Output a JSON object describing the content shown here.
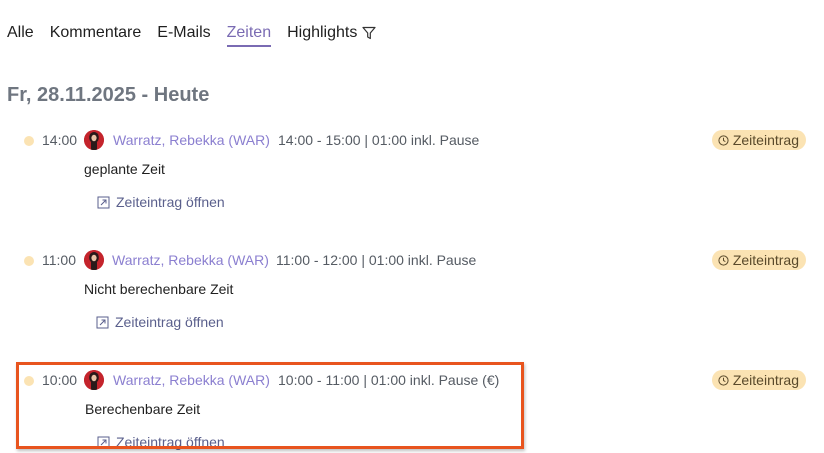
{
  "tabs": [
    {
      "label": "Alle",
      "active": false
    },
    {
      "label": "Kommentare",
      "active": false
    },
    {
      "label": "E-Mails",
      "active": false
    },
    {
      "label": "Zeiten",
      "active": true
    },
    {
      "label": "Highlights",
      "active": false,
      "icon": "filter-icon"
    }
  ],
  "date_heading": "Fr, 28.11.2025 - Heute",
  "entries": [
    {
      "time": "14:00",
      "user": "Warratz, Rebekka (WAR)",
      "details": "14:00 - 15:00 | 01:00 inkl. Pause",
      "badge": "Zeiteintrag",
      "description": "geplante Zeit",
      "link": "Zeiteintrag öffnen"
    },
    {
      "time": "11:00",
      "user": "Warratz, Rebekka (WAR)",
      "details": "11:00 - 12:00 | 01:00 inkl. Pause",
      "badge": "Zeiteintrag",
      "description": "Nicht berechenbare Zeit",
      "link": "Zeiteintrag öffnen"
    },
    {
      "time": "10:00",
      "user": "Warratz, Rebekka (WAR)",
      "details": "10:00 - 11:00 | 01:00 inkl. Pause (€)",
      "badge": "Zeiteintrag",
      "description": "Berechenbare Zeit",
      "link": "Zeiteintrag öffnen",
      "highlighted": true
    }
  ],
  "colors": {
    "accent": "#7a6bb3",
    "user_link": "#8b7fd0",
    "badge_bg": "#fbe3b3",
    "dot": "#fbe3b3",
    "highlight_border": "#e8541e",
    "heading": "#6f7680"
  }
}
